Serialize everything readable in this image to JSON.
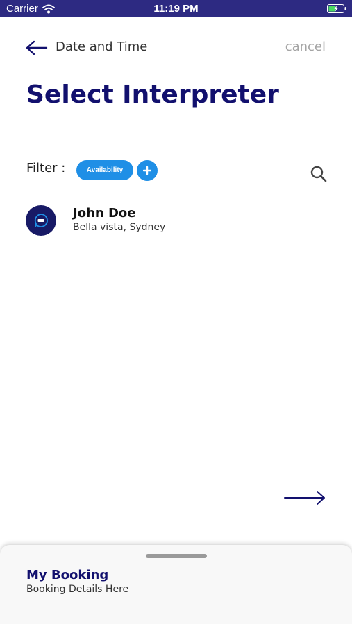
{
  "status_bar": {
    "carrier": "Carrier",
    "time": "11:19 PM",
    "wifi_icon": "wifi-icon",
    "battery_icon": "battery-charging-icon"
  },
  "header": {
    "back_icon": "arrow-left-icon",
    "back_label": "Date and Time",
    "cancel_label": "cancel"
  },
  "page": {
    "title": "Select Interpreter"
  },
  "filter": {
    "label": "Filter :",
    "chips": [
      "Availability"
    ],
    "add_icon": "plus-icon",
    "search_icon": "search-icon"
  },
  "interpreters": [
    {
      "name": "John Doe",
      "location": "Bella vista, Sydney",
      "avatar_icon": "app-logo-icon"
    }
  ],
  "navigation": {
    "next_icon": "arrow-right-icon"
  },
  "booking_sheet": {
    "title": "My Booking",
    "subtitle": "Booking Details Here"
  },
  "colors": {
    "status_bar": "#2d2a82",
    "title": "#12106e",
    "accent": "#1f8fe6",
    "muted": "#a5a5a5",
    "avatar_bg": "#181a66"
  }
}
